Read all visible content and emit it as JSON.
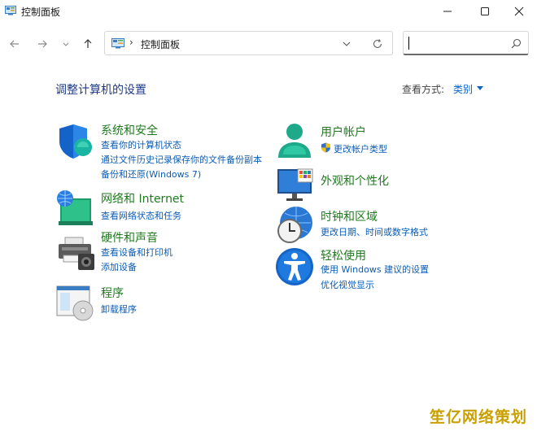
{
  "window": {
    "title": "控制面板",
    "app_icon": "control-panel-icon"
  },
  "nav": {
    "back_icon": "arrow-left-icon",
    "forward_icon": "arrow-right-icon",
    "recent_icon": "chevron-down-icon",
    "up_icon": "arrow-up-icon",
    "address_separator": "›",
    "address_text": "控制面板",
    "search_value": "",
    "search_placeholder": ""
  },
  "header": {
    "heading": "调整计算机的设置",
    "view_by_label": "查看方式:",
    "view_by_value": "类别"
  },
  "categories": {
    "system": {
      "icon": "shield-icon",
      "title": "系统和安全",
      "links": [
        "查看你的计算机状态",
        "通过文件历史记录保存你的文件备份副本",
        "备份和还原(Windows 7)"
      ]
    },
    "network": {
      "icon": "network-globe-icon",
      "title": "网络和 Internet",
      "links": [
        "查看网络状态和任务"
      ]
    },
    "hardware": {
      "icon": "printer-icon",
      "title": "硬件和声音",
      "links": [
        "查看设备和打印机",
        "添加设备"
      ]
    },
    "programs": {
      "icon": "programs-icon",
      "title": "程序",
      "links": [
        "卸载程序"
      ]
    },
    "users": {
      "icon": "user-icon",
      "title": "用户帐户",
      "links": [
        "更改帐户类型"
      ]
    },
    "appearance": {
      "icon": "monitor-icon",
      "title": "外观和个性化",
      "links": []
    },
    "clock": {
      "icon": "clock-globe-icon",
      "title": "时钟和区域",
      "links": [
        "更改日期、时间或数字格式"
      ]
    },
    "ease": {
      "icon": "accessibility-icon",
      "title": "轻松使用",
      "links": [
        "使用 Windows 建议的设置",
        "优化视觉显示"
      ]
    }
  },
  "watermark": "笙亿网络策划"
}
